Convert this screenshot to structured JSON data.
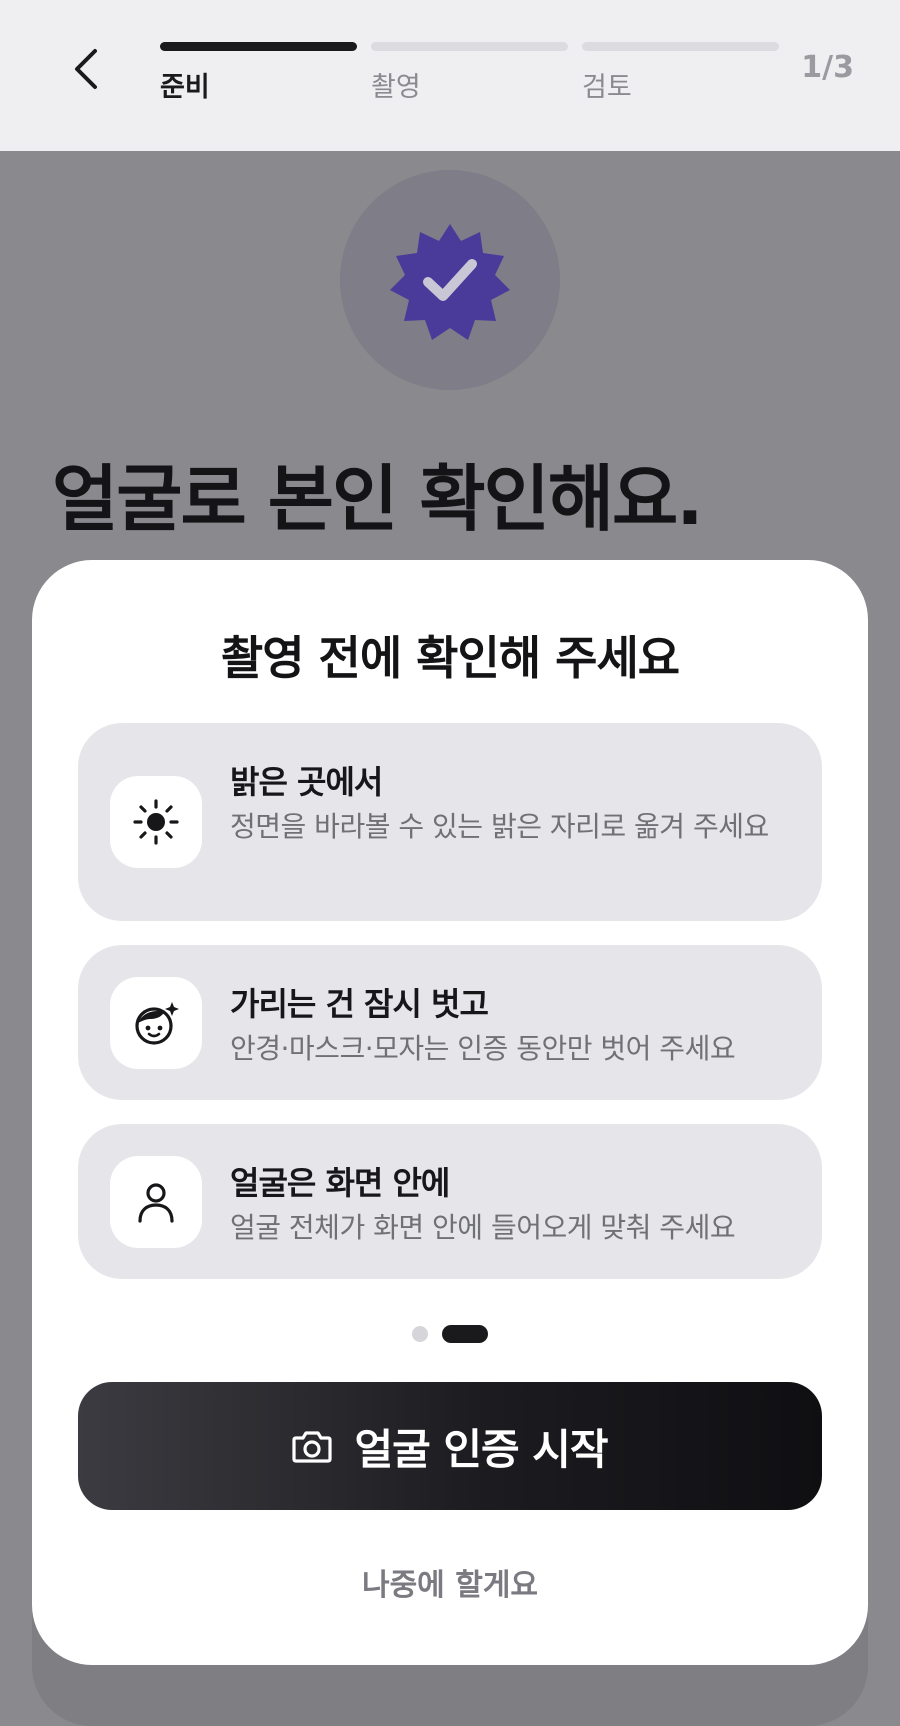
{
  "header": {
    "steps": [
      {
        "label": "준비"
      },
      {
        "label": "촬영"
      },
      {
        "label": "검토"
      }
    ],
    "active_step": 0,
    "step_count": "1/3"
  },
  "background": {
    "title": "얼굴로 본인 확인해요."
  },
  "sheet": {
    "title": "촬영 전에 확인해 주세요",
    "cards": [
      {
        "icon": "sun-icon",
        "title": "밝은 곳에서",
        "desc": "정면을 바라볼 수 있는 밝은 자리로 옮겨 주세요"
      },
      {
        "icon": "face-icon",
        "title": "가리는 건 잠시 벗고",
        "desc": "안경·마스크·모자는 인증 동안만 벗어 주세요"
      },
      {
        "icon": "person-icon",
        "title": "얼굴은 화면 안에",
        "desc": "얼굴 전체가 화면 안에 들어오게 맞춰 주세요"
      }
    ],
    "pagination": {
      "total": 2,
      "current": 1
    },
    "primary_button": "얼굴 인증 시작",
    "secondary_button": "나중에 할게요"
  },
  "colors": {
    "accent": "#4a3a9a",
    "primary_button": "#1c1c20",
    "overlay": "#8a898e"
  }
}
